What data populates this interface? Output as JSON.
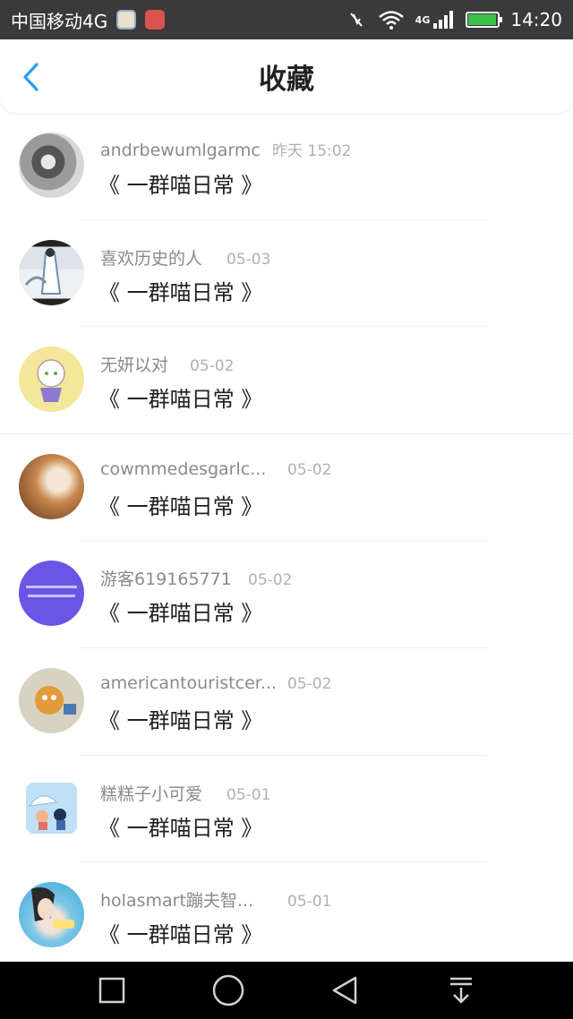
{
  "status_bar": {
    "carrier": "中国移动4G",
    "network_badge": "4G",
    "time": "14:20",
    "battery_fraction": 0.95,
    "battery_color": "#3cc24b"
  },
  "header": {
    "title": "收藏",
    "back_icon": "chevron-left-icon",
    "accent": "#2a9df4"
  },
  "favorites": [
    {
      "user": "andrbewumlgarmc",
      "date": "昨天 15:02",
      "work": "《 一群喵日常 》"
    },
    {
      "user": "喜欢历史的人",
      "date": "05-03",
      "work": "《 一群喵日常 》"
    },
    {
      "user": "无妍以对",
      "date": "05-02",
      "work": "《 一群喵日常 》"
    },
    {
      "user": "cowmmedesgarlc...",
      "date": "05-02",
      "work": "《 一群喵日常 》"
    },
    {
      "user": "游客619165771",
      "date": "05-02",
      "work": "《 一群喵日常 》"
    },
    {
      "user": "americantouristcer...",
      "date": "05-02",
      "work": "《 一群喵日常 》"
    },
    {
      "user": "糕糕子小可爱",
      "date": "05-01",
      "work": "《 一群喵日常 》"
    },
    {
      "user": "holasmart蹦夫智...",
      "date": "05-01",
      "work": "《 一群喵日常 》"
    }
  ],
  "nav_bar": {
    "icons": [
      "square-recents-icon",
      "circle-home-icon",
      "triangle-back-icon",
      "pull-down-icon"
    ]
  }
}
